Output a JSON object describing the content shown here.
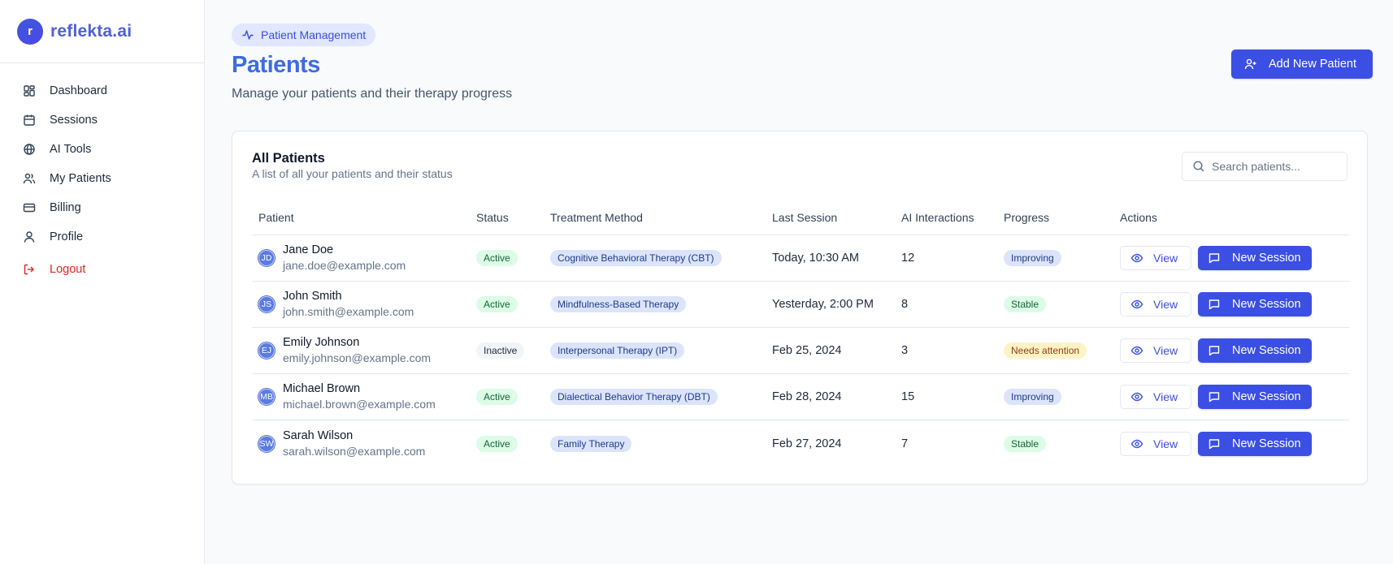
{
  "brand": {
    "logo_letter": "r",
    "name": "reflekta.ai"
  },
  "sidebar": {
    "items": [
      {
        "label": "Dashboard",
        "icon": "dashboard-icon"
      },
      {
        "label": "Sessions",
        "icon": "calendar-icon"
      },
      {
        "label": "AI Tools",
        "icon": "globe-icon"
      },
      {
        "label": "My Patients",
        "icon": "users-icon"
      },
      {
        "label": "Billing",
        "icon": "credit-card-icon"
      },
      {
        "label": "Profile",
        "icon": "user-icon"
      }
    ],
    "logout": {
      "label": "Logout",
      "icon": "logout-icon"
    }
  },
  "header": {
    "pill_label": "Patient Management",
    "title": "Patients",
    "subtitle": "Manage your patients and their therapy progress",
    "add_button": "Add New Patient"
  },
  "card": {
    "title": "All Patients",
    "subtitle": "A list of all your patients and their status",
    "search_placeholder": "Search patients..."
  },
  "table": {
    "columns": [
      "Patient",
      "Status",
      "Treatment Method",
      "Last Session",
      "AI Interactions",
      "Progress",
      "Actions"
    ],
    "view_label": "View",
    "new_session_label": "New Session",
    "rows": [
      {
        "initials": "JD",
        "name": "Jane Doe",
        "email": "jane.doe@example.com",
        "status": "Active",
        "method": "Cognitive Behavioral Therapy (CBT)",
        "last_session": "Today, 10:30 AM",
        "ai_interactions": "12",
        "progress": "Improving"
      },
      {
        "initials": "JS",
        "name": "John Smith",
        "email": "john.smith@example.com",
        "status": "Active",
        "method": "Mindfulness-Based Therapy",
        "last_session": "Yesterday, 2:00 PM",
        "ai_interactions": "8",
        "progress": "Stable"
      },
      {
        "initials": "EJ",
        "name": "Emily Johnson",
        "email": "emily.johnson@example.com",
        "status": "Inactive",
        "method": "Interpersonal Therapy (IPT)",
        "last_session": "Feb 25, 2024",
        "ai_interactions": "3",
        "progress": "Needs attention"
      },
      {
        "initials": "MB",
        "name": "Michael Brown",
        "email": "michael.brown@example.com",
        "status": "Active",
        "method": "Dialectical Behavior Therapy (DBT)",
        "last_session": "Feb 28, 2024",
        "ai_interactions": "15",
        "progress": "Improving"
      },
      {
        "initials": "SW",
        "name": "Sarah Wilson",
        "email": "sarah.wilson@example.com",
        "status": "Active",
        "method": "Family Therapy",
        "last_session": "Feb 27, 2024",
        "ai_interactions": "7",
        "progress": "Stable"
      }
    ]
  },
  "colors": {
    "accent": "#3b4fe4",
    "title_blue": "#3f6ae0",
    "logout_red": "#dc2626"
  }
}
